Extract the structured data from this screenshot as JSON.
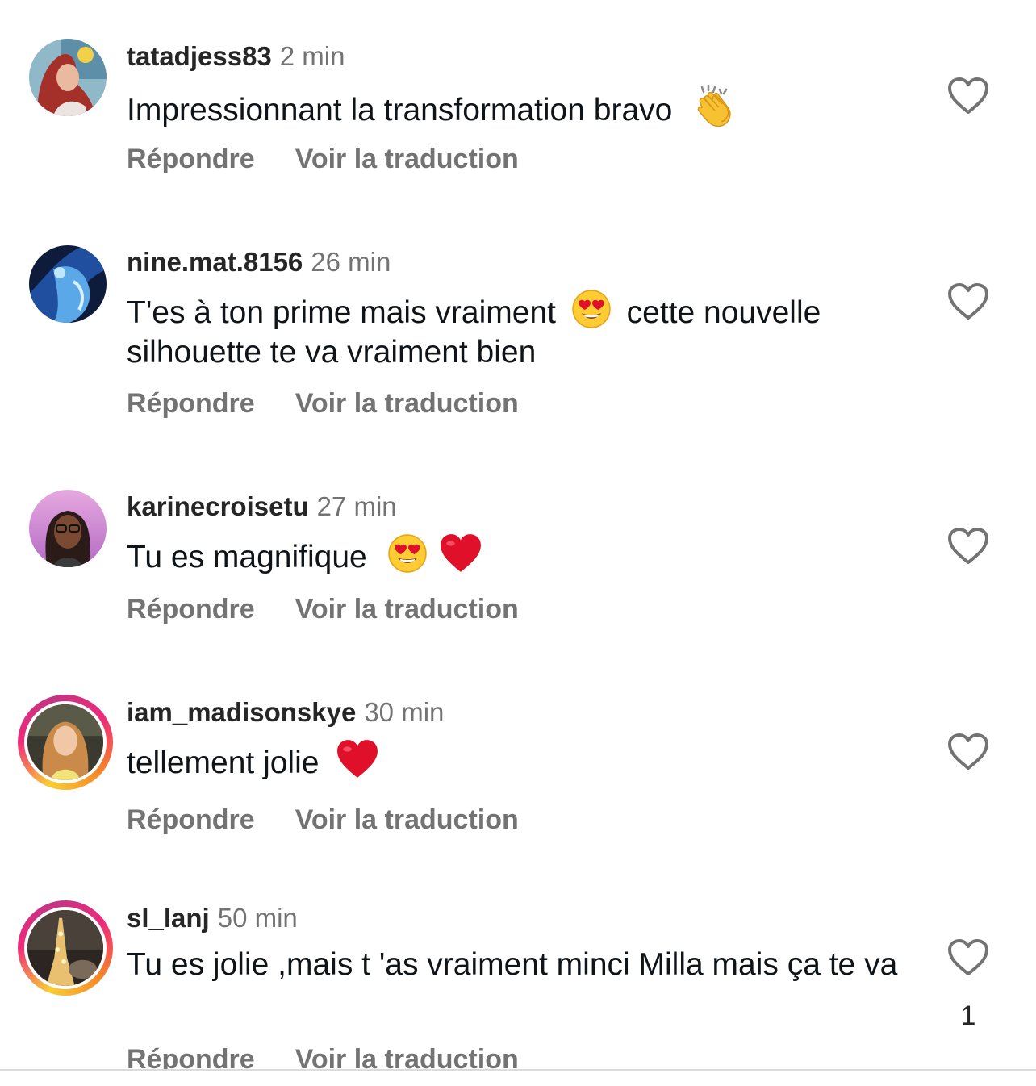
{
  "comments": [
    {
      "username": "tatadjess83",
      "time": "2 min",
      "text": "Impressionnant la transformation bravo",
      "emojis": [
        "clapping-hands"
      ],
      "reply": "Répondre",
      "translate": "Voir la traduction",
      "likes": ""
    },
    {
      "username": "nine.mat.8156",
      "time": "26 min",
      "text_a": "T'es à ton prime mais vraiment",
      "text_b": "cette nouvelle silhouette te va vraiment bien",
      "emojis": [
        "heart-eyes"
      ],
      "reply": "Répondre",
      "translate": "Voir la traduction",
      "likes": ""
    },
    {
      "username": "karinecroisetu",
      "time": "27 min",
      "text": "Tu es magnifique",
      "emojis": [
        "heart-eyes",
        "red-heart"
      ],
      "reply": "Répondre",
      "translate": "Voir la traduction",
      "likes": ""
    },
    {
      "username": "iam_madisonskye",
      "time": "30 min",
      "text": "tellement jolie",
      "emojis": [
        "red-heart"
      ],
      "reply": "Répondre",
      "translate": "Voir la traduction",
      "likes": ""
    },
    {
      "username": "sl_lanj",
      "time": "50 min",
      "text": "Tu es jolie ,mais t 'as vraiment minci Milla mais ça te va",
      "emojis": [],
      "reply": "Répondre",
      "translate": "Voir la traduction",
      "likes": "1"
    }
  ],
  "colors": {
    "username": "#262626",
    "meta": "#737373",
    "heart_emoji": "#e0102a",
    "story_ring": [
      "#f9ce34",
      "#ee2a7b",
      "#c13584"
    ]
  }
}
